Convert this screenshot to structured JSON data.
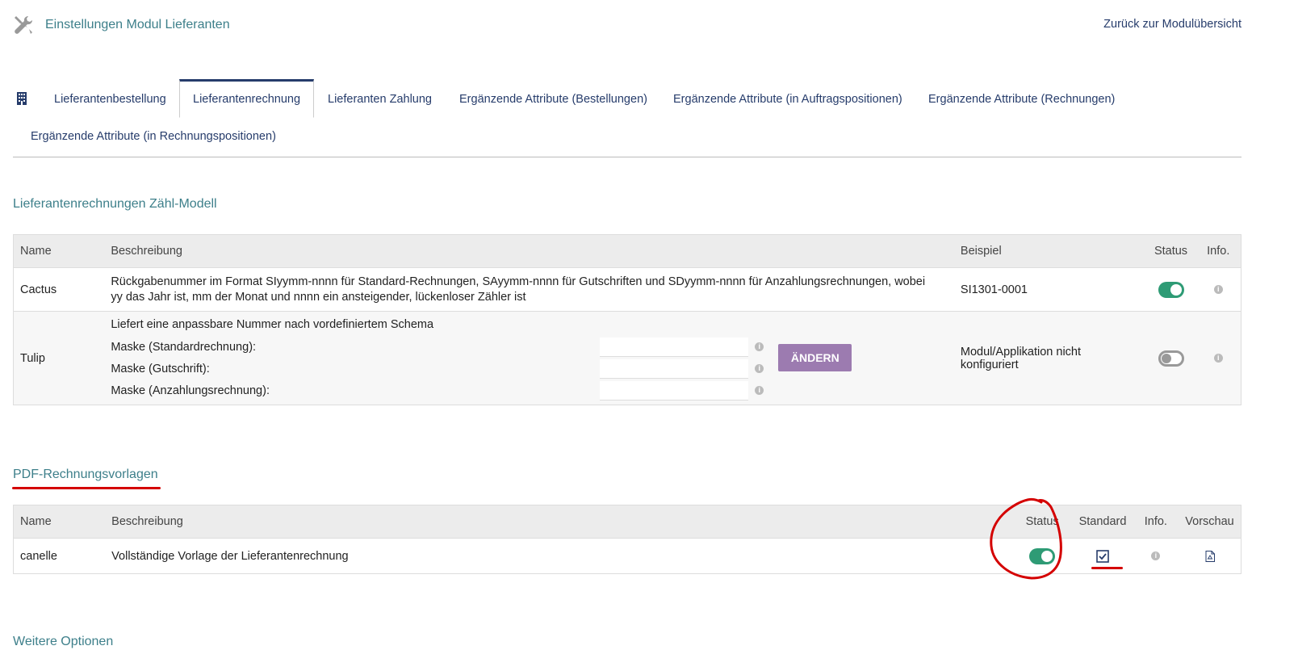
{
  "header": {
    "title": "Einstellungen Modul Lieferanten",
    "back_link": "Zurück zur Modulübersicht"
  },
  "tabs": [
    {
      "label": "Lieferantenbestellung"
    },
    {
      "label": "Lieferantenrechnung",
      "active": true
    },
    {
      "label": "Lieferanten Zahlung"
    },
    {
      "label": "Ergänzende Attribute (Bestellungen)"
    },
    {
      "label": "Ergänzende Attribute (in Auftragspositionen)"
    },
    {
      "label": "Ergänzende Attribute (Rechnungen)"
    },
    {
      "label": "Ergänzende Attribute (in Rechnungspositionen)"
    }
  ],
  "numbering": {
    "title": "Lieferantenrechnungen Zähl-Modell",
    "headers": {
      "name": "Name",
      "description": "Beschreibung",
      "example": "Beispiel",
      "status": "Status",
      "info": "Info."
    },
    "rows": [
      {
        "name": "Cactus",
        "description": "Rückgabenummer im Format SIyymm-nnnn für Standard-Rechnungen, SAyymm-nnnn für Gutschriften und SDyymm-nnnn für Anzahlungsrechnungen, wobei yy das Jahr ist, mm der Monat und nnnn ein ansteigender, lückenloser Zähler ist",
        "example": "SI1301-0001",
        "status": "on"
      },
      {
        "name": "Tulip",
        "description": "Liefert eine anpassbare Nummer nach vordefiniertem Schema",
        "masks": [
          {
            "label": "Maske (Standardrechnung):",
            "value": ""
          },
          {
            "label": "Maske (Gutschrift):",
            "value": ""
          },
          {
            "label": "Maske (Anzahlungsrechnung):",
            "value": ""
          }
        ],
        "button": "ÄNDERN",
        "example": "Modul/Applikation nicht konfiguriert",
        "status": "off"
      }
    ]
  },
  "pdf": {
    "title": "PDF-Rechnungsvorlagen",
    "headers": {
      "name": "Name",
      "description": "Beschreibung",
      "status": "Status",
      "default": "Standard",
      "info": "Info.",
      "preview": "Vorschau"
    },
    "rows": [
      {
        "name": "canelle",
        "description": "Vollständige Vorlage der Lieferantenrechnung",
        "status": "on",
        "default": true
      }
    ]
  },
  "more_options": {
    "title": "Weitere Optionen"
  },
  "colors": {
    "accent": "#3d7f8a",
    "toggle_on": "#2e9b75",
    "button": "#9c7bb0",
    "annotation": "#d40000"
  }
}
